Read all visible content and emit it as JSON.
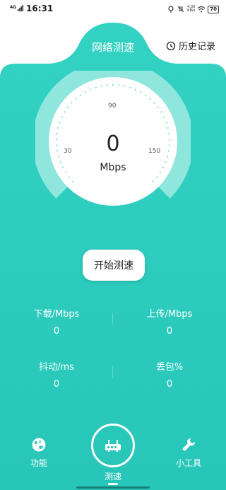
{
  "status_bar": {
    "network": "4G",
    "time": "16:31",
    "net_speed_value": "4.30",
    "net_speed_unit": "KB/s",
    "battery": "70"
  },
  "header": {
    "title": "网络测速",
    "history_label": "历史记录"
  },
  "gauge": {
    "value": "0",
    "unit": "Mbps",
    "tick_30": "30",
    "tick_90": "90",
    "tick_150": "150"
  },
  "start_button": "开始测速",
  "stats": {
    "download": {
      "label": "下载/Mbps",
      "value": "0"
    },
    "upload": {
      "label": "上传/Mbps",
      "value": "0"
    },
    "jitter": {
      "label": "抖动/ms",
      "value": "0"
    },
    "loss": {
      "label": "丢包%",
      "value": "0"
    }
  },
  "nav": {
    "functions": "功能",
    "speedtest": "测速",
    "tools": "小工具"
  },
  "colors": {
    "primary": "#2ecfc0",
    "primary_dark": "#22bdb0",
    "ring_light": "#8fe6dc"
  }
}
